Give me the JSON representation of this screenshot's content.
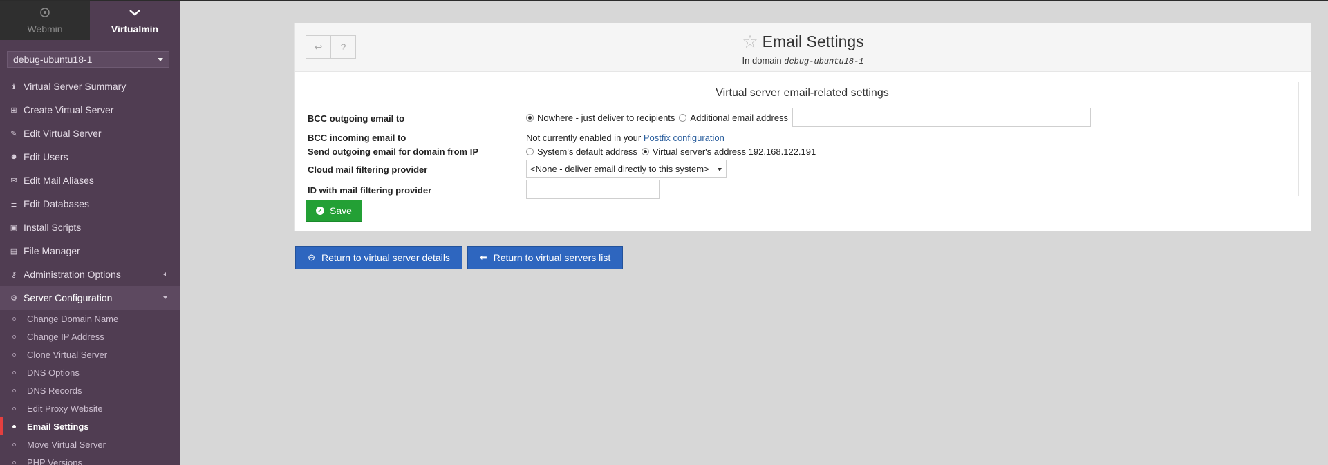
{
  "sidebar": {
    "tabs": [
      {
        "label": "Webmin",
        "icon": "webmin-icon"
      },
      {
        "label": "Virtualmin",
        "icon": "chevron-down-icon"
      }
    ],
    "domain_selected": "debug-ubuntu18-1",
    "menu": [
      {
        "label": "Virtual Server Summary",
        "icon": "info-icon"
      },
      {
        "label": "Create Virtual Server",
        "icon": "plus-square-icon"
      },
      {
        "label": "Edit Virtual Server",
        "icon": "edit-icon"
      },
      {
        "label": "Edit Users",
        "icon": "users-icon"
      },
      {
        "label": "Edit Mail Aliases",
        "icon": "envelope-icon"
      },
      {
        "label": "Edit Databases",
        "icon": "database-icon"
      },
      {
        "label": "Install Scripts",
        "icon": "terminal-icon"
      },
      {
        "label": "File Manager",
        "icon": "folder-icon"
      },
      {
        "label": "Administration Options",
        "icon": "key-icon"
      },
      {
        "label": "Server Configuration",
        "icon": "cogs-icon"
      }
    ],
    "submenu": [
      {
        "label": "Change Domain Name"
      },
      {
        "label": "Change IP Address"
      },
      {
        "label": "Clone Virtual Server"
      },
      {
        "label": "DNS Options"
      },
      {
        "label": "DNS Records"
      },
      {
        "label": "Edit Proxy Website"
      },
      {
        "label": "Email Settings"
      },
      {
        "label": "Move Virtual Server"
      },
      {
        "label": "PHP Versions"
      }
    ]
  },
  "page": {
    "title": "Email Settings",
    "subtitle_prefix": "In domain",
    "subtitle_domain": "debug-ubuntu18-1"
  },
  "form": {
    "section_title": "Virtual server email-related settings",
    "bcc_outgoing": {
      "label": "BCC outgoing email to",
      "option_nowhere": "Nowhere - just deliver to recipients",
      "option_additional": "Additional email address",
      "address_value": ""
    },
    "bcc_incoming": {
      "label": "BCC incoming email to",
      "text": "Not currently enabled in your",
      "link": "Postfix configuration"
    },
    "send_from_ip": {
      "label": "Send outgoing email for domain from IP",
      "option_default": "System's default address",
      "option_virtual": "Virtual server's address 192.168.122.191"
    },
    "cloud_provider": {
      "label": "Cloud mail filtering provider",
      "selected": "<None - deliver email directly to this system>"
    },
    "provider_id": {
      "label": "ID with mail filtering provider",
      "value": ""
    },
    "save_label": "Save"
  },
  "footer": {
    "return_details": "Return to virtual server details",
    "return_list": "Return to virtual servers list"
  }
}
